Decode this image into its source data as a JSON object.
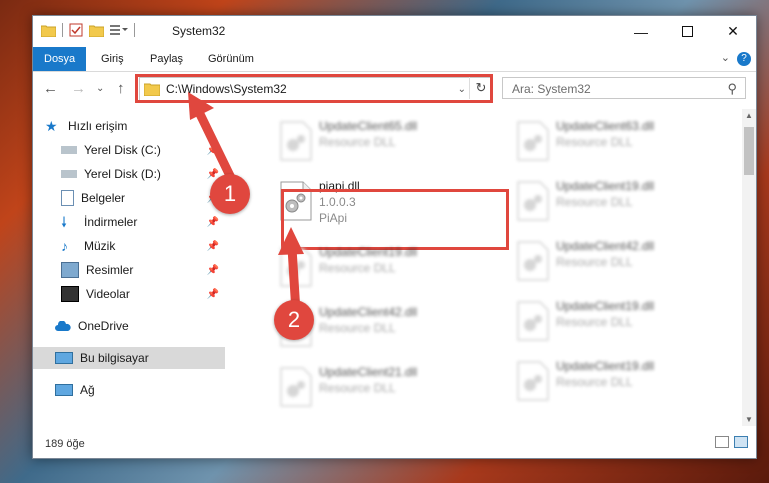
{
  "window": {
    "title": "System32"
  },
  "ribbon": {
    "tabs": [
      "Dosya",
      "Giriş",
      "Paylaş",
      "Görünüm"
    ],
    "help": "?"
  },
  "addressbar": {
    "path": "C:\\Windows\\System32",
    "search_placeholder": "Ara: System32"
  },
  "sidebar": {
    "quick_access": "Hızlı erişim",
    "items": [
      "Yerel Disk (C:)",
      "Yerel Disk (D:)",
      "Belgeler",
      "İndirmeler",
      "Müzik",
      "Resimler",
      "Videolar"
    ],
    "onedrive": "OneDrive",
    "this_pc": "Bu bilgisayar",
    "network": "Ağ"
  },
  "files": {
    "left": [
      {
        "name": "UpdateClient65.dll",
        "type": "Resource DLL"
      },
      {
        "name": "piapi.dll",
        "version": "1.0.0.3",
        "desc": "PiApi"
      },
      {
        "name": "UpdateClient19.dll",
        "type": "Resource DLL"
      },
      {
        "name": "UpdateClient42.dll",
        "type": "Resource DLL"
      },
      {
        "name": "UpdateClient21.dll",
        "type": "Resource DLL"
      }
    ],
    "right": [
      {
        "name": "UpdateClient63.dll",
        "type": "Resource DLL"
      },
      {
        "name": "UpdateClient19.dll",
        "type": "Resource DLL"
      },
      {
        "name": "UpdateClient42.dll",
        "type": "Resource DLL"
      },
      {
        "name": "UpdateClient19.dll",
        "type": "Resource DLL"
      },
      {
        "name": "UpdateClient19.dll",
        "type": "Resource DLL"
      }
    ]
  },
  "status": {
    "count": "189 öğe"
  },
  "badges": {
    "one": "1",
    "two": "2"
  },
  "colors": {
    "accent": "#1979ca",
    "highlight": "#e0473e"
  }
}
